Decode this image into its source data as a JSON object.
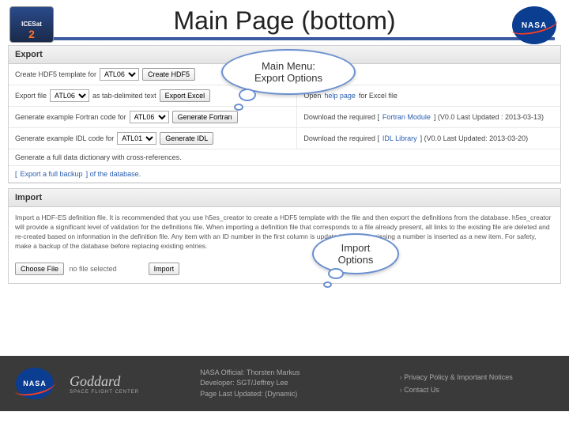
{
  "header": {
    "title": "Main Page (bottom)"
  },
  "logos": {
    "icesat": "ICESat",
    "icesat_num": "2",
    "nasa": "NASA"
  },
  "bubbles": {
    "b1a": "Main Menu:",
    "b1b": "Export Options",
    "b2a": "Import",
    "b2b": "Options"
  },
  "export": {
    "title": "Export",
    "r1_label": "Create HDF5 template for",
    "r1_sel": "ATL06",
    "r1_btn": "Create HDF5",
    "r2_label": "Export file",
    "r2_sel": "ATL06",
    "r2_mid": "as tab-delimited text",
    "r2_btn": "Export Excel",
    "r2_right_a": "Open",
    "r2_right_link": "help page",
    "r2_right_b": "for Excel file",
    "r3_label": "Generate example Fortran code for",
    "r3_sel": "ATL06",
    "r3_btn": "Generate Fortran",
    "r3_right_a": "Download the required [",
    "r3_right_link": "Fortran Module",
    "r3_right_b": "] (V0.0 Last Updated : 2013-03-13)",
    "r4_label": "Generate example IDL code for",
    "r4_sel": "ATL01",
    "r4_btn": "Generate IDL",
    "r4_right_a": "Download the required [",
    "r4_right_link": "IDL Library",
    "r4_right_b": "] (V0.0 Last Updated: 2013-03-20)",
    "r5": "Generate a full data dictionary with cross-references.",
    "r6_a": "[",
    "r6_link": "Export a full backup",
    "r6_b": "] of the database."
  },
  "import": {
    "title": "Import",
    "para": "Import a HDF-ES definition file. It is recommended that you use h5es_creator to create a HDF5 template with the file and then export the definitions from the database. h5es_creator will provide a significant level of validation for the definitions file. When importing a definition file that corresponds to a file already present, all links to the existing file are deleted and re-created based on information in the definition file. Any item with an ID number in the first column is updated. Any item missing a number is inserted as a new item. For safety, make a backup of the database before replacing existing entries.",
    "choose_btn": "Choose File",
    "no_file": "no file selected",
    "import_btn": "Import"
  },
  "footer": {
    "official_label": "NASA Official:",
    "official": "Thorsten Markus",
    "dev_label": "Developer:",
    "dev": "SGT/Jeffrey Lee",
    "updated_label": "Page Last Updated:",
    "updated": "(Dynamic)",
    "link1": "Privacy Policy & Important Notices",
    "link2": "Contact Us",
    "goddard": "Goddard",
    "goddard_sub": "SPACE FLIGHT CENTER"
  }
}
